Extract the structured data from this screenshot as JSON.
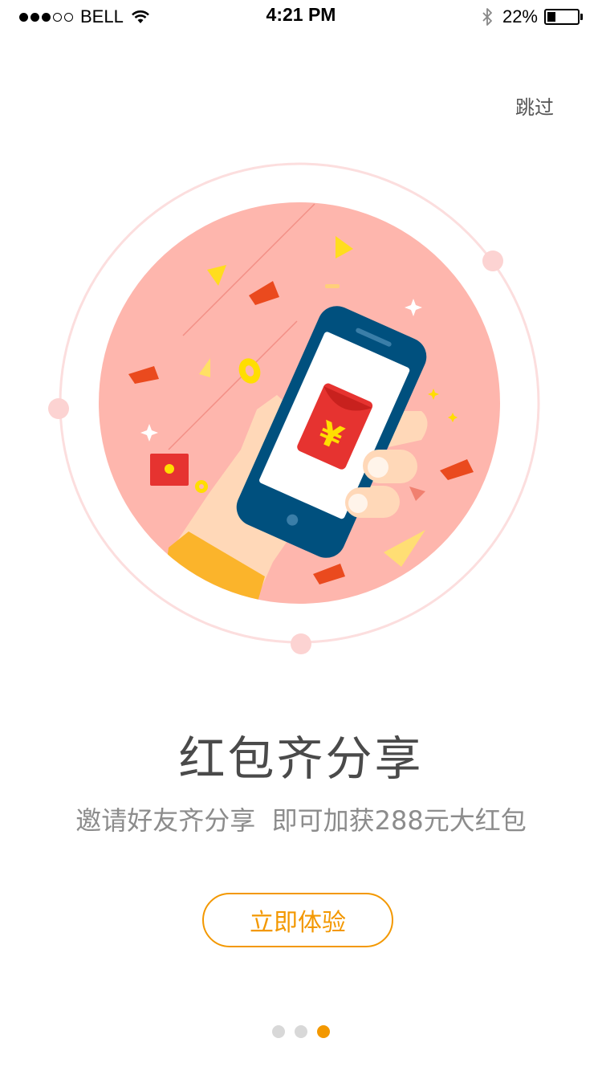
{
  "status_bar": {
    "carrier": "BELL",
    "time": "4:21 PM",
    "battery_percent": "22%",
    "battery_level": 0.22,
    "signal_strength": 3,
    "signal_total": 5
  },
  "skip_label": "跳过",
  "illustration": {
    "envelope_symbol": "¥"
  },
  "title": "红包齐分享",
  "subtitle": "邀请好友齐分享  即可加获288元大红包",
  "cta_label": "立即体验",
  "pagination": {
    "total": 3,
    "active_index": 2
  },
  "colors": {
    "accent": "#f39800",
    "circle_fill": "#feb6ad",
    "ring": "#fcdede",
    "phone_frame": "#00507e",
    "envelope_red": "#e63330",
    "coin_yellow": "#ffde00"
  }
}
